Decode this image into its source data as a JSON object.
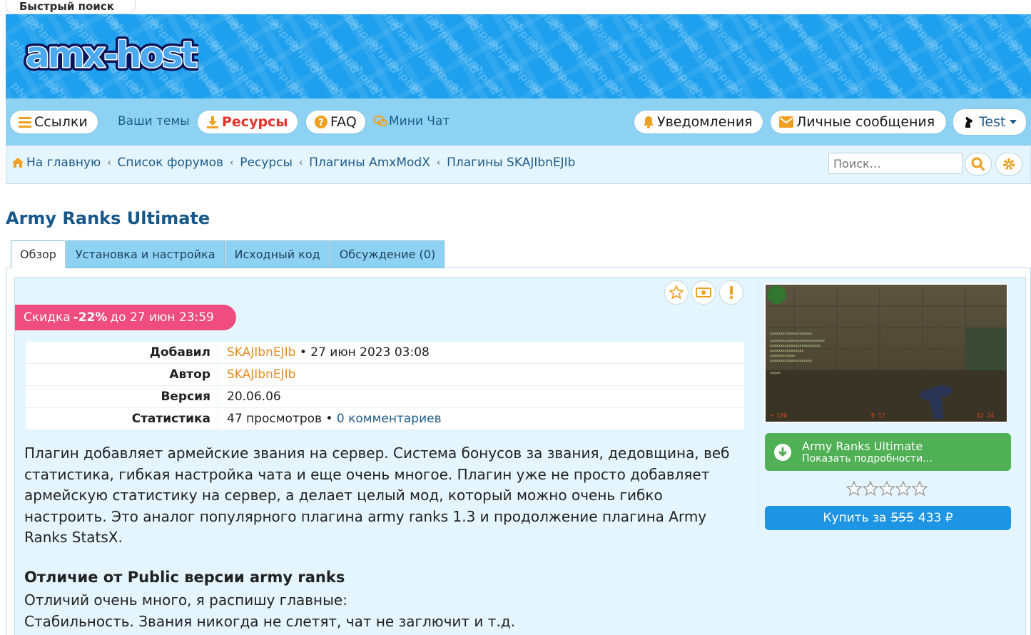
{
  "quick_search": "Быстрый поиск",
  "logo_text": "amx-host",
  "watermark_text": "phpBB",
  "nav": {
    "links_label": "Ссылки",
    "your_topics_label": "Ваши темы",
    "resources_label": "Ресурсы",
    "faq_label": "FAQ",
    "mini_chat_label": "Мини Чат",
    "notifications_label": "Уведомления",
    "messages_label": "Личные сообщения",
    "user_label": "Test"
  },
  "breadcrumbs": [
    "На главную",
    "Список форумов",
    "Ресурсы",
    "Плагины AmxModX",
    "Плагины SKAJIbnEJIb"
  ],
  "search": {
    "placeholder": "Поиск…"
  },
  "page_title": "Army Ranks Ultimate",
  "tabs": [
    "Обзор",
    "Установка и настройка",
    "Исходный код",
    "Обсуждение (0)"
  ],
  "discount": {
    "prefix": "Скидка",
    "percent": "-22%",
    "suffix": "до 27 июн 23:59"
  },
  "info": {
    "added_label": "Добавил",
    "added_user": "SKAJIbnEJIb",
    "added_date": "• 27 июн 2023 03:08",
    "author_label": "Автор",
    "author_value": "SKAJIbnEJIb",
    "version_label": "Версия",
    "version_value": "20.06.06",
    "stats_label": "Статистика",
    "stats_views": "47 просмотров •",
    "stats_comments": "0 комментариев"
  },
  "description": "Плагин добавляет армейские звания на сервер. Система бонусов за звания, дедовщина, веб статистика, гибкая настройка чата и еще очень многое. Плагин уже не просто добавляет армейскую статистику на сервер, а делает целый мод, который можно очень гибко настроить. Это аналог популярного плагина army ranks 1.3 и продолжение плагина Army Ranks StatsX.",
  "section_heading": "Отличие от Public версии army ranks",
  "section_lines": [
    "Отличий очень много, я распишу главные:",
    "Стабильность. Звания никогда не слетят, чат не заглючит и т.д."
  ],
  "sidebar": {
    "download_title": "Army Ranks Ultimate",
    "download_subtitle": "Показать подробности…",
    "rating_stars": 0,
    "buy_prefix": "Купить за",
    "old_price": "555",
    "new_price": "433 ₽"
  },
  "colors": {
    "banner": "#1ea0ee",
    "navbar": "#8ed2f3",
    "content_bg": "#e4f5fd",
    "discount": "#ef4d7f",
    "download": "#4fb055",
    "buy": "#1d95e4",
    "accent_orange": "#e68a1c",
    "link_blue": "#1e5c8a"
  },
  "icons": [
    "bars-icon",
    "download-icon",
    "question-icon",
    "chat-icon",
    "bell-icon",
    "envelope-icon",
    "avatar-icon",
    "caret-down-icon",
    "home-icon",
    "search-icon",
    "gear-icon",
    "star-icon",
    "money-icon",
    "exclamation-icon",
    "arrow-down-circle-icon"
  ]
}
